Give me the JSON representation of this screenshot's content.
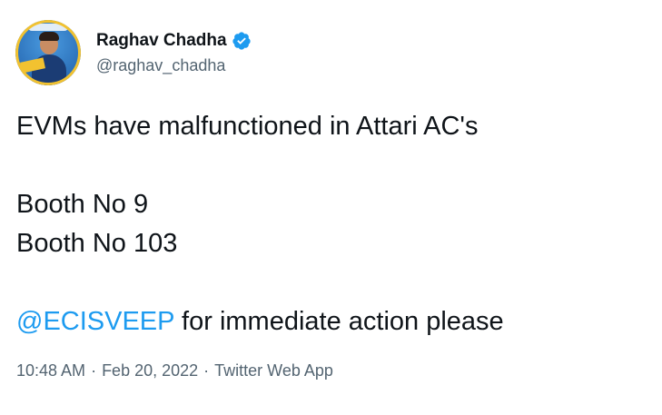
{
  "author": {
    "display_name": "Raghav Chadha",
    "handle": "@raghav_chadha",
    "verified": true,
    "verified_color": "#1d9bf0"
  },
  "tweet": {
    "line1": "EVMs have malfunctioned in Attari AC's",
    "line2": "Booth No 9",
    "line3": "Booth No 103",
    "mention": "@ECISVEEP",
    "line4_rest": " for immediate action please"
  },
  "meta": {
    "time": "10:48 AM",
    "separator": "·",
    "date": "Feb 20, 2022",
    "source": "Twitter Web App"
  },
  "colors": {
    "text": "#0f1419",
    "secondary": "#536471",
    "link": "#1d9bf0"
  }
}
